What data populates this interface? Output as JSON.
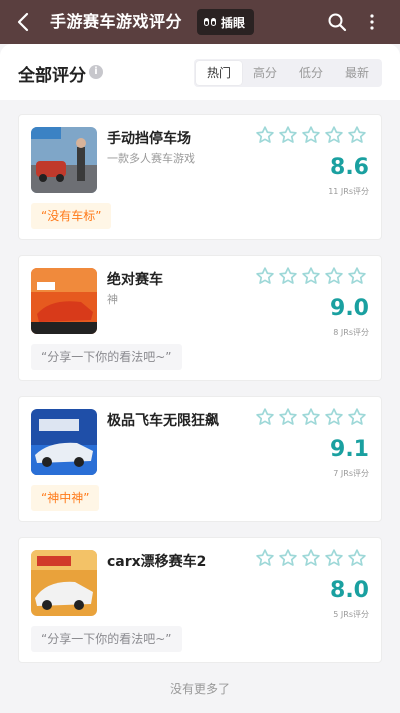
{
  "topbar": {
    "title": "手游赛车游戏评分",
    "chip_label": "插眼"
  },
  "header": {
    "section_title": "全部评分",
    "tabs": [
      {
        "label": "热门"
      },
      {
        "label": "高分"
      },
      {
        "label": "低分"
      },
      {
        "label": "最新"
      }
    ],
    "active_tab": "热门"
  },
  "games": [
    {
      "name": "手动挡停车场",
      "desc": "一款多人赛车游戏",
      "score": "8.6",
      "count": "11 JRs评分",
      "comment": "“没有车标”",
      "comment_type": "tag"
    },
    {
      "name": "绝对赛车",
      "desc": "神",
      "score": "9.0",
      "count": "8 JRs评分",
      "comment": "“分享一下你的看法吧~”",
      "comment_type": "placeholder"
    },
    {
      "name": "极品飞车无限狂飙",
      "desc": "",
      "score": "9.1",
      "count": "7 JRs评分",
      "comment": "“神中神”",
      "comment_type": "tag"
    },
    {
      "name": "carx漂移赛车2",
      "desc": "",
      "score": "8.0",
      "count": "5 JRs评分",
      "comment": "“分享一下你的看法吧~”",
      "comment_type": "placeholder"
    }
  ],
  "footer": {
    "text": "没有更多了"
  },
  "colors": {
    "topbar": "#5a3f3f",
    "score": "#1aa0a0",
    "star_outline": "#9ed8d8",
    "tag_text": "#ff7a1a"
  }
}
